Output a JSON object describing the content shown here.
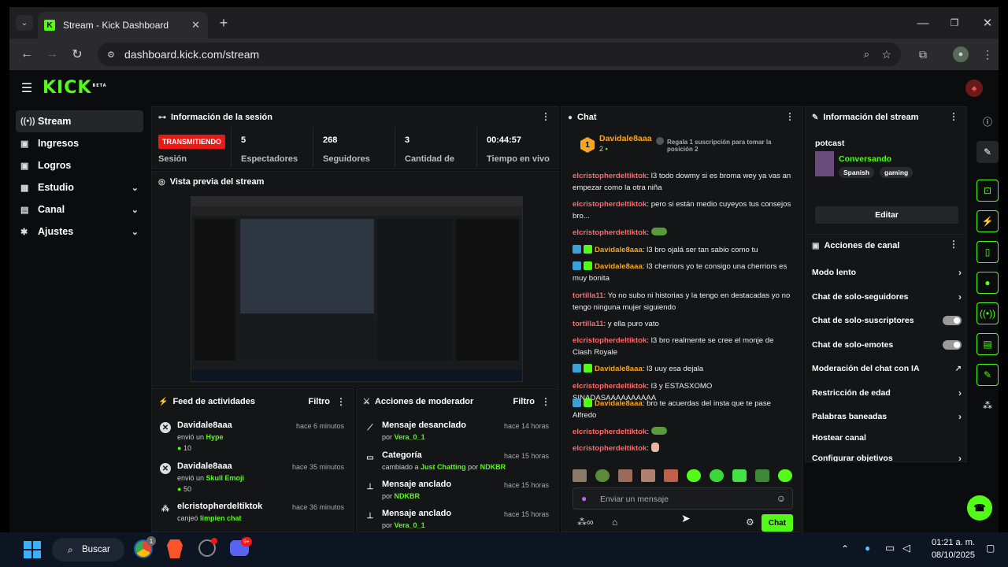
{
  "browser": {
    "tab_title": "Stream - Kick Dashboard",
    "url": "dashboard.kick.com/stream"
  },
  "kick": {
    "logo": "KICK",
    "logo_tag": "BETA"
  },
  "sidebar": {
    "items": [
      {
        "label": "Stream",
        "icon": "stream-icon"
      },
      {
        "label": "Ingresos",
        "icon": "income-icon"
      },
      {
        "label": "Logros",
        "icon": "trophy-icon"
      },
      {
        "label": "Estudio",
        "icon": "studio-icon"
      },
      {
        "label": "Canal",
        "icon": "channel-icon"
      },
      {
        "label": "Ajustes",
        "icon": "settings-icon"
      }
    ]
  },
  "session": {
    "title": "Información de la sesión",
    "status": "TRANSMITIENDO",
    "status_label": "Sesión",
    "stats": [
      {
        "value": "5",
        "label": "Espectadores"
      },
      {
        "value": "268",
        "label": "Seguidores"
      },
      {
        "value": "3",
        "label": "Cantidad de"
      },
      {
        "value": "00:44:57",
        "label": "Tiempo en vivo"
      }
    ]
  },
  "preview": {
    "title": "Vista previa del stream"
  },
  "feed": {
    "title": "Feed de actividades",
    "filter": "Filtro",
    "items": [
      {
        "name": "Davidale8aaa",
        "time": "hace 6 minutos",
        "text": "envió un",
        "item": "Hype",
        "amount": "10"
      },
      {
        "name": "Davidale8aaa",
        "time": "hace 35 minutos",
        "text": "envió un",
        "item": "Skull Emoji",
        "amount": "50"
      },
      {
        "name": "elcristopherdeltiktok",
        "time": "hace 36 minutos",
        "text": "canjeó",
        "item": "limpien chat",
        "amount": ""
      }
    ]
  },
  "mod": {
    "title": "Acciones de moderador",
    "filter": "Filtro",
    "items": [
      {
        "title": "Mensaje desanclado",
        "time": "hace 14 horas",
        "pre": "por",
        "who": "Vera_0_1",
        "mid": "",
        "extra": ""
      },
      {
        "title": "Categoría",
        "time": "hace 15 horas",
        "pre": "cambiado a",
        "who": "Just Chatting",
        "mid": "por",
        "extra": "NDKBR"
      },
      {
        "title": "Mensaje anclado",
        "time": "hace 15 horas",
        "pre": "por",
        "who": "NDKBR",
        "mid": "",
        "extra": ""
      },
      {
        "title": "Mensaje anclado",
        "time": "hace 15 horas",
        "pre": "por",
        "who": "Vera_0_1",
        "mid": "",
        "extra": ""
      }
    ]
  },
  "chat": {
    "title": "Chat",
    "top_gifter": "Davidale8aaa",
    "top_count": "2",
    "gift_prompt": "Regala 1 suscripción para tomar la posición 2",
    "messages": [
      {
        "user": "elcristopherdeltiktok",
        "text": ": l3 todo dowmy si es broma wey ya vas an empezar como la otra niña",
        "kind": "u"
      },
      {
        "user": "elcristopherdeltiktok",
        "text": ": pero si están medio cuyeyos tus consejos bro...",
        "kind": "u"
      },
      {
        "user": "elcristopherdeltiktok",
        "text": ":",
        "kind": "u"
      },
      {
        "user": "Davidale8aaa",
        "text": ": l3 bro ojalá ser tan sabio como tu",
        "kind": "d"
      },
      {
        "user": "Davidale8aaa",
        "text": ": l3 cherriors yo te consigo una cherriors es muy bonita",
        "kind": "d"
      },
      {
        "user": "tortilla11",
        "text": ": Yo no subo ni historias y la tengo en destacadas yo no tengo ninguna mujer siguiendo",
        "kind": "u"
      },
      {
        "user": "tortilla11",
        "text": ": y ella puro vato",
        "kind": "u"
      },
      {
        "user": "elcristopherdeltiktok",
        "text": ": l3 bro realmente se cree el monje de Clash Royale",
        "kind": "u"
      },
      {
        "user": "Davidale8aaa",
        "text": ": l3 uuy esa dejala",
        "kind": "d"
      },
      {
        "user": "elcristopherdeltiktok",
        "text": ": l3 y ESTASXOMO SINADASAAAAAAAAAA",
        "kind": "u"
      },
      {
        "user": "Davidale8aaa",
        "text": ": bro te acuerdas del insta que te pase Alfredo",
        "kind": "d"
      },
      {
        "user": "elcristopherdeltiktok",
        "text": ":",
        "kind": "u"
      },
      {
        "user": "elcristopherdeltiktok",
        "text": ":",
        "kind": "u"
      }
    ],
    "input_placeholder": "Enviar un mensaje",
    "send": "Chat"
  },
  "streaminfo": {
    "title": "Información del stream",
    "stream_title": "potcast",
    "category": "Conversando",
    "tags": [
      "Spanish",
      "gaming"
    ],
    "edit": "Editar"
  },
  "channel_actions": {
    "title": "Acciones de canal",
    "items": [
      {
        "label": "Modo lento",
        "control": "chevron"
      },
      {
        "label": "Chat de solo-seguidores",
        "control": "chevron"
      },
      {
        "label": "Chat de solo-suscriptores",
        "control": "toggle"
      },
      {
        "label": "Chat de solo-emotes",
        "control": "toggle"
      },
      {
        "label": "Moderación del chat con IA",
        "control": "external"
      },
      {
        "label": "Restricción de edad",
        "control": "chevron"
      },
      {
        "label": "Palabras baneadas",
        "control": "chevron"
      },
      {
        "label": "Hostear canal",
        "control": "none"
      },
      {
        "label": "Configurar objetivos",
        "control": "chevron"
      }
    ]
  },
  "taskbar": {
    "search": "Buscar",
    "time": "01:21 a. m.",
    "date": "08/10/2025",
    "chrome_badge": "1",
    "discord_badge": "9+"
  },
  "colors": {
    "accent": "#53fc18",
    "live": "#e91916",
    "user": "#ff6868",
    "gold": "#f5a623"
  }
}
